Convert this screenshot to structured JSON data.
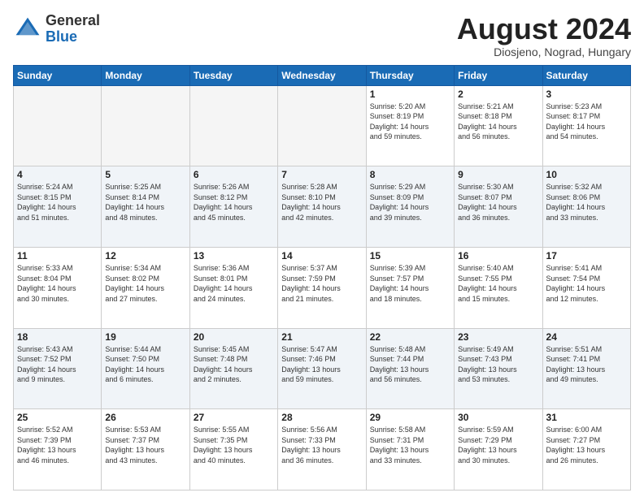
{
  "header": {
    "logo_general": "General",
    "logo_blue": "Blue",
    "month_title": "August 2024",
    "subtitle": "Diosjeno, Nograd, Hungary"
  },
  "weekdays": [
    "Sunday",
    "Monday",
    "Tuesday",
    "Wednesday",
    "Thursday",
    "Friday",
    "Saturday"
  ],
  "weeks": [
    [
      {
        "day": "",
        "empty": true
      },
      {
        "day": "",
        "empty": true
      },
      {
        "day": "",
        "empty": true
      },
      {
        "day": "",
        "empty": true
      },
      {
        "day": "1",
        "info": "Sunrise: 5:20 AM\nSunset: 8:19 PM\nDaylight: 14 hours\nand 59 minutes."
      },
      {
        "day": "2",
        "info": "Sunrise: 5:21 AM\nSunset: 8:18 PM\nDaylight: 14 hours\nand 56 minutes."
      },
      {
        "day": "3",
        "info": "Sunrise: 5:23 AM\nSunset: 8:17 PM\nDaylight: 14 hours\nand 54 minutes."
      }
    ],
    [
      {
        "day": "4",
        "info": "Sunrise: 5:24 AM\nSunset: 8:15 PM\nDaylight: 14 hours\nand 51 minutes."
      },
      {
        "day": "5",
        "info": "Sunrise: 5:25 AM\nSunset: 8:14 PM\nDaylight: 14 hours\nand 48 minutes."
      },
      {
        "day": "6",
        "info": "Sunrise: 5:26 AM\nSunset: 8:12 PM\nDaylight: 14 hours\nand 45 minutes."
      },
      {
        "day": "7",
        "info": "Sunrise: 5:28 AM\nSunset: 8:10 PM\nDaylight: 14 hours\nand 42 minutes."
      },
      {
        "day": "8",
        "info": "Sunrise: 5:29 AM\nSunset: 8:09 PM\nDaylight: 14 hours\nand 39 minutes."
      },
      {
        "day": "9",
        "info": "Sunrise: 5:30 AM\nSunset: 8:07 PM\nDaylight: 14 hours\nand 36 minutes."
      },
      {
        "day": "10",
        "info": "Sunrise: 5:32 AM\nSunset: 8:06 PM\nDaylight: 14 hours\nand 33 minutes."
      }
    ],
    [
      {
        "day": "11",
        "info": "Sunrise: 5:33 AM\nSunset: 8:04 PM\nDaylight: 14 hours\nand 30 minutes."
      },
      {
        "day": "12",
        "info": "Sunrise: 5:34 AM\nSunset: 8:02 PM\nDaylight: 14 hours\nand 27 minutes."
      },
      {
        "day": "13",
        "info": "Sunrise: 5:36 AM\nSunset: 8:01 PM\nDaylight: 14 hours\nand 24 minutes."
      },
      {
        "day": "14",
        "info": "Sunrise: 5:37 AM\nSunset: 7:59 PM\nDaylight: 14 hours\nand 21 minutes."
      },
      {
        "day": "15",
        "info": "Sunrise: 5:39 AM\nSunset: 7:57 PM\nDaylight: 14 hours\nand 18 minutes."
      },
      {
        "day": "16",
        "info": "Sunrise: 5:40 AM\nSunset: 7:55 PM\nDaylight: 14 hours\nand 15 minutes."
      },
      {
        "day": "17",
        "info": "Sunrise: 5:41 AM\nSunset: 7:54 PM\nDaylight: 14 hours\nand 12 minutes."
      }
    ],
    [
      {
        "day": "18",
        "info": "Sunrise: 5:43 AM\nSunset: 7:52 PM\nDaylight: 14 hours\nand 9 minutes."
      },
      {
        "day": "19",
        "info": "Sunrise: 5:44 AM\nSunset: 7:50 PM\nDaylight: 14 hours\nand 6 minutes."
      },
      {
        "day": "20",
        "info": "Sunrise: 5:45 AM\nSunset: 7:48 PM\nDaylight: 14 hours\nand 2 minutes."
      },
      {
        "day": "21",
        "info": "Sunrise: 5:47 AM\nSunset: 7:46 PM\nDaylight: 13 hours\nand 59 minutes."
      },
      {
        "day": "22",
        "info": "Sunrise: 5:48 AM\nSunset: 7:44 PM\nDaylight: 13 hours\nand 56 minutes."
      },
      {
        "day": "23",
        "info": "Sunrise: 5:49 AM\nSunset: 7:43 PM\nDaylight: 13 hours\nand 53 minutes."
      },
      {
        "day": "24",
        "info": "Sunrise: 5:51 AM\nSunset: 7:41 PM\nDaylight: 13 hours\nand 49 minutes."
      }
    ],
    [
      {
        "day": "25",
        "info": "Sunrise: 5:52 AM\nSunset: 7:39 PM\nDaylight: 13 hours\nand 46 minutes."
      },
      {
        "day": "26",
        "info": "Sunrise: 5:53 AM\nSunset: 7:37 PM\nDaylight: 13 hours\nand 43 minutes."
      },
      {
        "day": "27",
        "info": "Sunrise: 5:55 AM\nSunset: 7:35 PM\nDaylight: 13 hours\nand 40 minutes."
      },
      {
        "day": "28",
        "info": "Sunrise: 5:56 AM\nSunset: 7:33 PM\nDaylight: 13 hours\nand 36 minutes."
      },
      {
        "day": "29",
        "info": "Sunrise: 5:58 AM\nSunset: 7:31 PM\nDaylight: 13 hours\nand 33 minutes."
      },
      {
        "day": "30",
        "info": "Sunrise: 5:59 AM\nSunset: 7:29 PM\nDaylight: 13 hours\nand 30 minutes."
      },
      {
        "day": "31",
        "info": "Sunrise: 6:00 AM\nSunset: 7:27 PM\nDaylight: 13 hours\nand 26 minutes."
      }
    ]
  ]
}
